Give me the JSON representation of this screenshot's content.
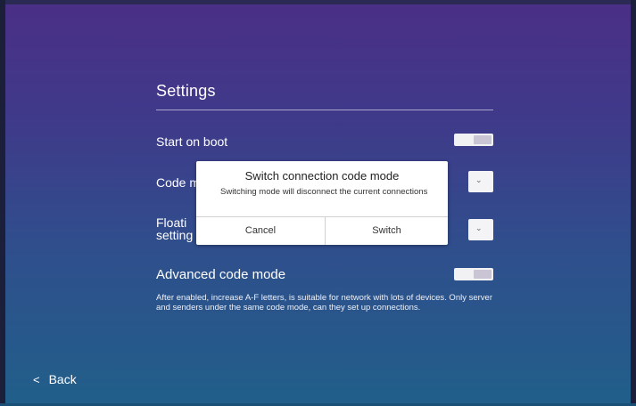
{
  "settings": {
    "title": "Settings",
    "rows": {
      "start_on_boot": {
        "label": "Start on boot",
        "toggle_on": true
      },
      "code_mode": {
        "label": "Code m"
      },
      "floating": {
        "label_line1": "Floati",
        "label_line2": "setting"
      },
      "advanced": {
        "label": "Advanced code mode",
        "toggle_on": true
      }
    },
    "description": "After enabled, increase A-F letters, is suitable for network with lots of devices. Only server and senders under the same code mode, can they set up connections."
  },
  "footer": {
    "back_label": "Back",
    "back_icon": "chevron-left-icon"
  },
  "dialog": {
    "title": "Switch connection code mode",
    "message": "Switching mode will disconnect the current connections",
    "cancel_label": "Cancel",
    "confirm_label": "Switch"
  },
  "icons": {
    "select_chevron": "chevron-down-icon"
  },
  "colors": {
    "background_top": "#4a2f86",
    "background_bottom": "#215f8a",
    "dialog_bg": "#ffffff",
    "toggle_track": "#f1f1f4"
  }
}
